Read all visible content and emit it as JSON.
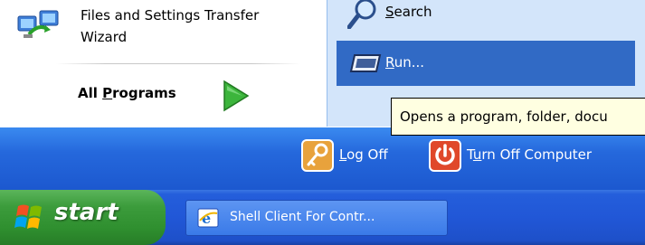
{
  "start_menu": {
    "left_items": [
      {
        "label_line1": "Files and Settings Transfer",
        "label_line2": "Wizard",
        "icon": "transfer-wizard-icon"
      }
    ],
    "all_programs": {
      "prefix": "All ",
      "accel": "P",
      "suffix": "rograms",
      "icon": "green-arrow-icon"
    },
    "right_items": [
      {
        "accel": "S",
        "suffix": "earch",
        "icon": "search-icon"
      },
      {
        "accel": "R",
        "suffix": "un...",
        "icon": "run-icon",
        "selected": true
      }
    ],
    "bottom": {
      "logoff": {
        "accel": "L",
        "suffix": "og Off",
        "icon": "key-icon"
      },
      "turnoff": {
        "prefix": "T",
        "accel": "u",
        "suffix": "rn Off Computer",
        "icon": "power-icon"
      }
    }
  },
  "tooltip": {
    "text": "Opens a program, folder, docu"
  },
  "taskbar": {
    "start_label": "start",
    "task_items": [
      {
        "label": "Shell Client For Contr...",
        "icon": "ie-icon"
      }
    ]
  },
  "colors": {
    "selection": "#316ac5",
    "right_pane": "#d3e5fa",
    "taskbar": "#245edb",
    "start_button": "#3c9c3c",
    "tooltip_bg": "#ffffe1"
  }
}
